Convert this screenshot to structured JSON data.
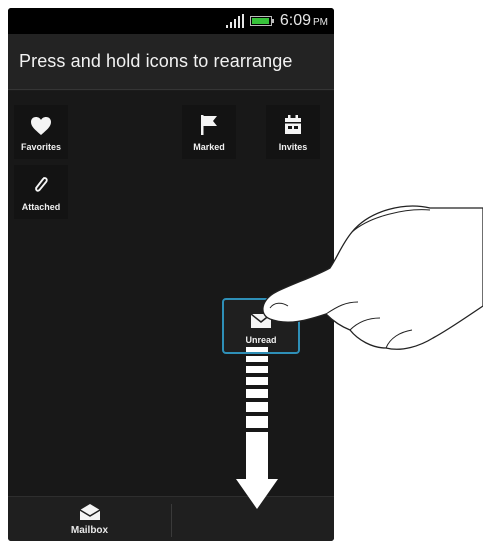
{
  "status_bar": {
    "time": "6:09",
    "ampm": "PM",
    "battery_color": "#37c23a"
  },
  "header": {
    "title": "Press and hold icons to rearrange"
  },
  "tiles": [
    {
      "label": "Favorites",
      "icon": "heart-icon"
    },
    {
      "label": "Marked",
      "icon": "flag-icon"
    },
    {
      "label": "Invites",
      "icon": "calendar-icon"
    },
    {
      "label": "Attached",
      "icon": "paperclip-icon"
    },
    {
      "label": "Unread",
      "icon": "envelope-icon"
    }
  ],
  "bottom_bar": {
    "mailbox_label": "Mailbox",
    "mailbox_icon": "open-envelope-icon"
  },
  "colors": {
    "highlight_border": "#2e8fb7",
    "background": "#181818"
  }
}
